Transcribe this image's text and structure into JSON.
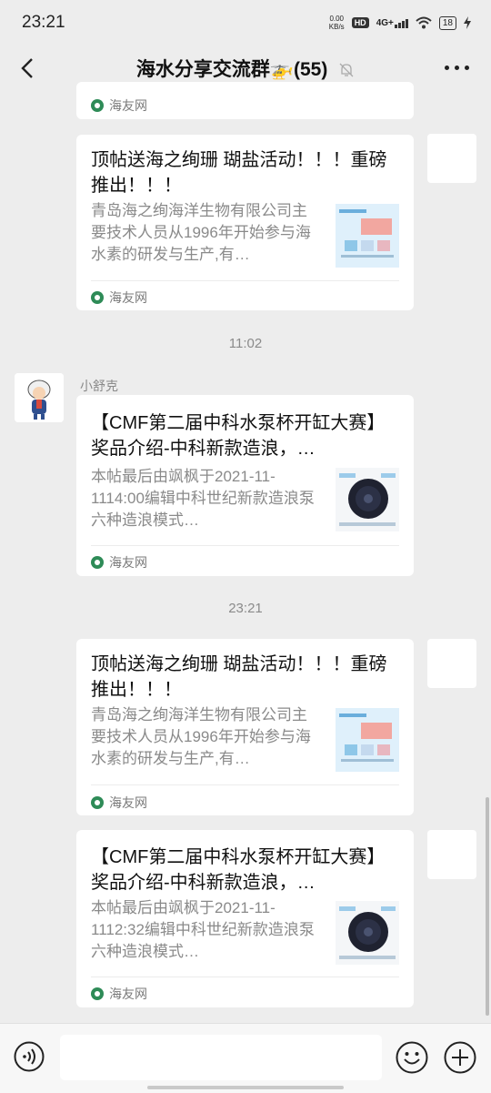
{
  "status": {
    "time": "23:21",
    "net_speed_value": "0.00",
    "net_speed_unit": "KB/s",
    "hd": "HD",
    "network": "4G+",
    "battery": "18"
  },
  "header": {
    "title": "海水分享交流群🚁(55)"
  },
  "messages": {
    "m0": {
      "source": "海友网"
    },
    "m1": {
      "title": "顶帖送海之绚珊 瑚盐活动！！！重磅推出！！！",
      "desc": "青岛海之绚海洋生物有限公司主要技术人员从1996年开始参与海水素的研发与生产,有…",
      "source": "海友网"
    },
    "ts1": "11:02",
    "m2": {
      "sender": "小舒克",
      "title": "【CMF第二届中科水泵杯开缸大赛】奖品介绍-中科新款造浪，…",
      "desc": "本帖最后由飒枫于2021-11-1114:00编辑中科世纪新款造浪泵六种造浪模式…",
      "source": "海友网"
    },
    "ts2": "23:21",
    "m3": {
      "title": "顶帖送海之绚珊 瑚盐活动！！！重磅推出！！！",
      "desc": "青岛海之绚海洋生物有限公司主要技术人员从1996年开始参与海水素的研发与生产,有…",
      "source": "海友网"
    },
    "m4": {
      "title": "【CMF第二届中科水泵杯开缸大赛】奖品介绍-中科新款造浪，…",
      "desc": "本帖最后由飒枫于2021-11-1112:32编辑中科世纪新款造浪泵六种造浪模式…",
      "source": "海友网"
    }
  },
  "colors": {
    "background": "#ededed",
    "card": "#ffffff",
    "source_icon": "#2e8b57"
  },
  "icons": [
    "back-arrow-icon",
    "mute-bell-icon",
    "more-icon",
    "voice-icon",
    "emoji-icon",
    "plus-icon"
  ]
}
